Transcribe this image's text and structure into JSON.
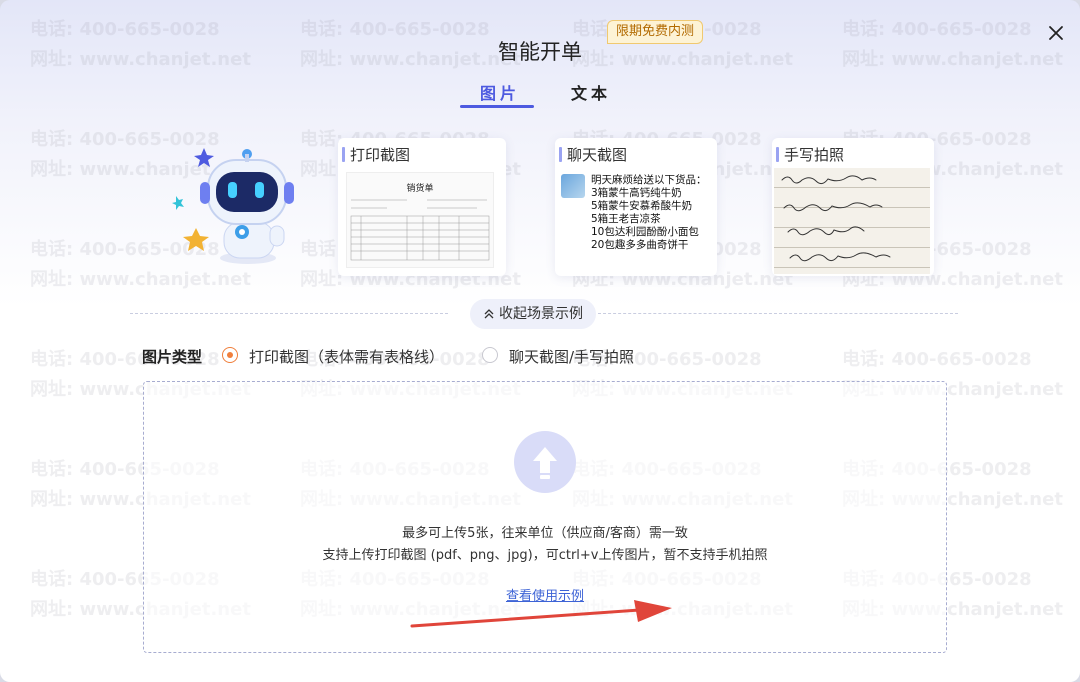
{
  "dialog": {
    "title": "智能开单",
    "badge": "限期免费内测",
    "close_icon": "close-icon"
  },
  "tabs": [
    {
      "label": "图片",
      "active": true
    },
    {
      "label": "文本",
      "active": false
    }
  ],
  "watermark": {
    "phone": "电话: 400-665-0028",
    "site": "网址: www.chanjet.net"
  },
  "examples": {
    "print": {
      "title": "打印截图",
      "receipt_title": "销货单"
    },
    "chat": {
      "title": "聊天截图",
      "lines": [
        "明天麻烦给送以下货品：",
        "3箱蒙牛高钙纯牛奶",
        "5箱蒙牛安慕希酸牛奶",
        "5箱王老吉凉茶",
        "10包达利园酚酚小面包",
        "20包趣多多曲奇饼干"
      ]
    },
    "handwritten": {
      "title": "手写拍照"
    },
    "collapse_label": "收起场景示例"
  },
  "image_type": {
    "label": "图片类型",
    "options": [
      {
        "label": "打印截图（表体需有表格线）",
        "selected": true
      },
      {
        "label": "聊天截图/手写拍照",
        "selected": false
      }
    ]
  },
  "upload": {
    "line1": "最多可上传5张，往来单位（供应商/客商）需一致",
    "line2": "支持上传打印截图 (pdf、png、jpg)，可ctrl+v上传图片，暂不支持手机拍照",
    "example_link": "查看使用示例"
  },
  "colors": {
    "accent": "#4d5ae0",
    "radio_on": "#f07f3c",
    "arrow": "#e0453a"
  }
}
